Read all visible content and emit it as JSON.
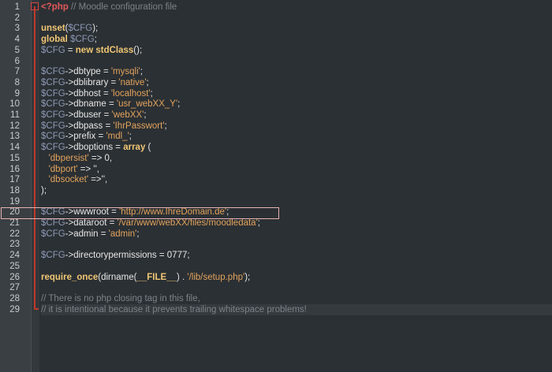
{
  "editor": {
    "lines": [
      {
        "n": "1",
        "t": [
          {
            "c": "php-open",
            "s": "<?php"
          },
          {
            "c": "cm",
            "s": " // Moodle configuration file"
          }
        ]
      },
      {
        "n": "2",
        "t": []
      },
      {
        "n": "3",
        "t": [
          {
            "c": "kw",
            "s": "unset"
          },
          {
            "c": "plain",
            "s": "("
          },
          {
            "c": "var",
            "s": "$CFG"
          },
          {
            "c": "plain",
            "s": ");"
          }
        ]
      },
      {
        "n": "4",
        "t": [
          {
            "c": "kw",
            "s": "global"
          },
          {
            "c": "plain",
            "s": " "
          },
          {
            "c": "var",
            "s": "$CFG"
          },
          {
            "c": "plain",
            "s": ";"
          }
        ]
      },
      {
        "n": "5",
        "t": [
          {
            "c": "var",
            "s": "$CFG"
          },
          {
            "c": "plain",
            "s": " = "
          },
          {
            "c": "kw",
            "s": "new"
          },
          {
            "c": "plain",
            "s": " "
          },
          {
            "c": "kw",
            "s": "stdClass"
          },
          {
            "c": "plain",
            "s": "();"
          }
        ]
      },
      {
        "n": "6",
        "t": []
      },
      {
        "n": "7",
        "t": [
          {
            "c": "var",
            "s": "$CFG"
          },
          {
            "c": "plain",
            "s": "->dbtype = "
          },
          {
            "c": "str",
            "s": "'mysqli'"
          },
          {
            "c": "plain",
            "s": ";"
          }
        ]
      },
      {
        "n": "8",
        "t": [
          {
            "c": "var",
            "s": "$CFG"
          },
          {
            "c": "plain",
            "s": "->dblibrary = "
          },
          {
            "c": "str",
            "s": "'native'"
          },
          {
            "c": "plain",
            "s": ";"
          }
        ]
      },
      {
        "n": "9",
        "t": [
          {
            "c": "var",
            "s": "$CFG"
          },
          {
            "c": "plain",
            "s": "->dbhost = "
          },
          {
            "c": "str",
            "s": "'localhost'"
          },
          {
            "c": "plain",
            "s": ";"
          }
        ]
      },
      {
        "n": "10",
        "t": [
          {
            "c": "var",
            "s": "$CFG"
          },
          {
            "c": "plain",
            "s": "->dbname = "
          },
          {
            "c": "str",
            "s": "'usr_webXX_Y'"
          },
          {
            "c": "plain",
            "s": ";"
          }
        ]
      },
      {
        "n": "11",
        "t": [
          {
            "c": "var",
            "s": "$CFG"
          },
          {
            "c": "plain",
            "s": "->dbuser = "
          },
          {
            "c": "str",
            "s": "'webXX'"
          },
          {
            "c": "plain",
            "s": ";"
          }
        ]
      },
      {
        "n": "12",
        "t": [
          {
            "c": "var",
            "s": "$CFG"
          },
          {
            "c": "plain",
            "s": "->dbpass = "
          },
          {
            "c": "str",
            "s": "'IhrPasswort'"
          },
          {
            "c": "plain",
            "s": ";"
          }
        ]
      },
      {
        "n": "13",
        "t": [
          {
            "c": "var",
            "s": "$CFG"
          },
          {
            "c": "plain",
            "s": "->prefix = "
          },
          {
            "c": "str",
            "s": "'mdl_'"
          },
          {
            "c": "plain",
            "s": ";"
          }
        ]
      },
      {
        "n": "14",
        "t": [
          {
            "c": "var",
            "s": "$CFG"
          },
          {
            "c": "plain",
            "s": "->dboptions = "
          },
          {
            "c": "kw",
            "s": "array"
          },
          {
            "c": "plain",
            "s": " ("
          }
        ]
      },
      {
        "n": "15",
        "t": [
          {
            "c": "plain",
            "s": "   "
          },
          {
            "c": "str",
            "s": "'dbpersist'"
          },
          {
            "c": "plain",
            "s": " => 0,"
          }
        ]
      },
      {
        "n": "16",
        "t": [
          {
            "c": "plain",
            "s": "   "
          },
          {
            "c": "str",
            "s": "'dbport'"
          },
          {
            "c": "plain",
            "s": " => '',"
          }
        ]
      },
      {
        "n": "17",
        "t": [
          {
            "c": "plain",
            "s": "   "
          },
          {
            "c": "str",
            "s": "'dbsocket'"
          },
          {
            "c": "plain",
            "s": " =>'',"
          }
        ]
      },
      {
        "n": "18",
        "t": [
          {
            "c": "plain",
            "s": ");"
          }
        ]
      },
      {
        "n": "19",
        "t": []
      },
      {
        "n": "20",
        "t": [
          {
            "c": "var",
            "s": "$CFG"
          },
          {
            "c": "plain",
            "s": "->wwwroot = "
          },
          {
            "c": "str",
            "s": "'http://www.IhreDomain.de'"
          },
          {
            "c": "plain",
            "s": ";"
          }
        ]
      },
      {
        "n": "21",
        "t": [
          {
            "c": "var",
            "s": "$CFG"
          },
          {
            "c": "plain",
            "s": "->dataroot = "
          },
          {
            "c": "str",
            "s": "'/var/www/webXX/files/moodledata'"
          },
          {
            "c": "plain",
            "s": ";"
          }
        ]
      },
      {
        "n": "22",
        "t": [
          {
            "c": "var",
            "s": "$CFG"
          },
          {
            "c": "plain",
            "s": "->admin = "
          },
          {
            "c": "str",
            "s": "'admin'"
          },
          {
            "c": "plain",
            "s": ";"
          }
        ]
      },
      {
        "n": "23",
        "t": []
      },
      {
        "n": "24",
        "t": [
          {
            "c": "var",
            "s": "$CFG"
          },
          {
            "c": "plain",
            "s": "->directorypermissions = 0777;"
          }
        ]
      },
      {
        "n": "25",
        "t": []
      },
      {
        "n": "26",
        "t": [
          {
            "c": "kw",
            "s": "require_once"
          },
          {
            "c": "plain",
            "s": "(dirname("
          },
          {
            "c": "kw",
            "s": "__FILE__"
          },
          {
            "c": "plain",
            "s": ") . "
          },
          {
            "c": "str",
            "s": "'/lib/setup.php'"
          },
          {
            "c": "plain",
            "s": ");"
          }
        ]
      },
      {
        "n": "27",
        "t": []
      },
      {
        "n": "28",
        "t": [
          {
            "c": "cm",
            "s": "// There is no php closing tag in this file,"
          }
        ]
      },
      {
        "n": "29",
        "t": [
          {
            "c": "cm",
            "s": "// it is intentional because it prevents trailing whitespace problems!"
          }
        ]
      }
    ],
    "current_line": "29",
    "highlighted_line": "20",
    "colors": {
      "background": "#2b3034",
      "gutter": "#3a3f43",
      "keyword": "#f0c674",
      "variable": "#8f99b5",
      "string": "#e3a35c",
      "comment": "#7b8389",
      "fold_marker": "#c0392b",
      "highlight_border": "#e8b4b4"
    }
  }
}
